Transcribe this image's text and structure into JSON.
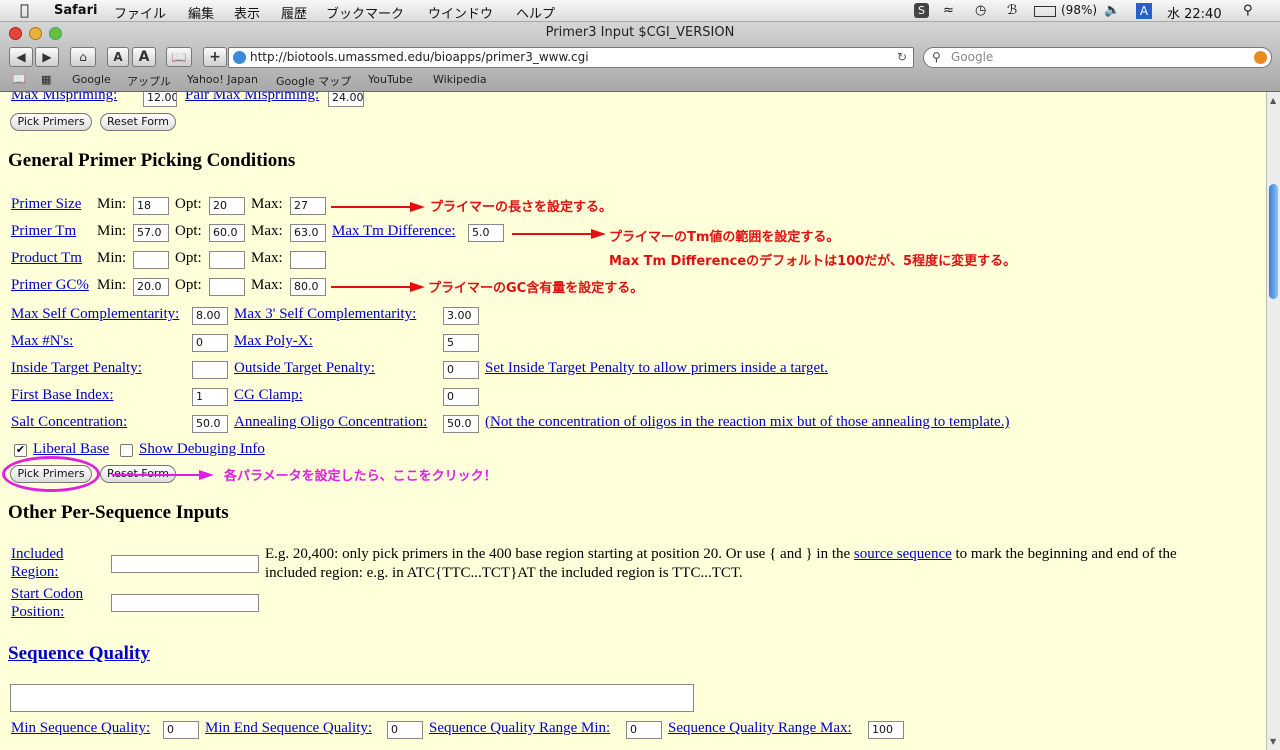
{
  "menubar": {
    "app": "Safari",
    "items": [
      "ファイル",
      "編集",
      "表示",
      "履歴",
      "ブックマーク",
      "ウインドウ",
      "ヘルプ"
    ],
    "battery": "(98%)",
    "input_indicator": "A",
    "clock": "水 22:40"
  },
  "window": {
    "title": "Primer3 Input $CGI_VERSION"
  },
  "toolbar": {
    "url": "http://biotools.umassmed.edu/bioapps/primer3_www.cgi",
    "search_placeholder": "Google",
    "text_smaller": "A",
    "text_bigger": "A",
    "add": "+"
  },
  "bookmarks": [
    "Google",
    "アップル",
    "Yahoo! Japan",
    "Google マップ",
    "YouTube",
    "Wikipedia"
  ],
  "top": {
    "max_mispriming_label": "Max Mispriming:",
    "max_mispriming_value": "12.00",
    "pair_max_mispriming_label": "Pair Max Mispriming:",
    "pair_max_mispriming_value": "24.00",
    "pick_primers": "Pick Primers",
    "reset_form": "Reset Form"
  },
  "general": {
    "heading": "General Primer Picking Conditions",
    "min_label": "Min:",
    "opt_label": "Opt:",
    "max_label": "Max:",
    "rows": [
      {
        "label": "Primer Size",
        "min": "18",
        "opt": "20",
        "max": "27"
      },
      {
        "label": "Primer Tm",
        "min": "57.0",
        "opt": "60.0",
        "max": "63.0"
      },
      {
        "label": "Product Tm",
        "min": "",
        "opt": "",
        "max": ""
      },
      {
        "label": "Primer GC%",
        "min": "20.0",
        "opt": "",
        "max": "80.0"
      }
    ],
    "max_tm_diff_label": "Max Tm Difference:",
    "max_tm_diff_value": "5.0",
    "max_self_comp_label": "Max Self Complementarity:",
    "max_self_comp_value": "8.00",
    "max_3_self_comp_label": "Max 3' Self Complementarity:",
    "max_3_self_comp_value": "3.00",
    "max_ns_label": "Max #N's:",
    "max_ns_value": "0",
    "max_polyx_label": "Max Poly-X:",
    "max_polyx_value": "5",
    "inside_target_label": "Inside Target Penalty:",
    "inside_target_value": "",
    "outside_target_label": "Outside Target Penalty:",
    "outside_target_value": "0",
    "inside_target_note": "Set Inside Target Penalty to allow primers inside a target.",
    "first_base_label": "First Base Index:",
    "first_base_value": "1",
    "cg_clamp_label": "CG Clamp:",
    "cg_clamp_value": "0",
    "salt_label": "Salt Concentration:",
    "salt_value": "50.0",
    "annealing_label": "Annealing Oligo Concentration:",
    "annealing_value": "50.0",
    "annealing_note": "(Not the concentration of oligos in the reaction mix but of those annealing to template.)",
    "liberal_base": "Liberal Base",
    "liberal_base_checked": true,
    "show_debug": "Show Debuging Info",
    "show_debug_checked": false,
    "pick_primers": "Pick Primers",
    "reset_form": "Reset Form"
  },
  "annotations": {
    "size": "プライマーの長さを設定する。",
    "tm": "プライマーのTm値の範囲を設定する。",
    "tm_diff": "Max Tm Differenceのデフォルトは100だが、5程度に変更する。",
    "gc": "プライマーのGC含有量を設定する。",
    "click": "各パラメータを設定したら、ここをクリック！"
  },
  "other": {
    "heading": "Other Per-Sequence Inputs",
    "included_label_1": "Included",
    "included_label_2": "Region:",
    "included_value": "",
    "included_note_1": "E.g. 20,400: only pick primers in the 400 base region starting at position 20. Or use { and } in the",
    "included_note_link": "source sequence",
    "included_note_2": "to mark the beginning and end of the",
    "included_note_3": "included region: e.g. in ATC{TTC...TCT}AT the included region is TTC...TCT.",
    "start_codon_label_1": "Start Codon",
    "start_codon_label_2": "Position:",
    "start_codon_value": ""
  },
  "quality": {
    "heading": "Sequence Quality",
    "textarea_value": "",
    "min_seq_label": "Min Sequence Quality:",
    "min_seq_value": "0",
    "min_end_label": "Min End Sequence Quality:",
    "min_end_value": "0",
    "range_min_label": "Sequence Quality Range Min:",
    "range_min_value": "0",
    "range_max_label": "Sequence Quality Range Max:",
    "range_max_value": "100"
  },
  "colors": {
    "page_bg": "#ffffd9",
    "link": "#0000cc",
    "annotation": "#e01010",
    "highlight": "#e020e0"
  }
}
